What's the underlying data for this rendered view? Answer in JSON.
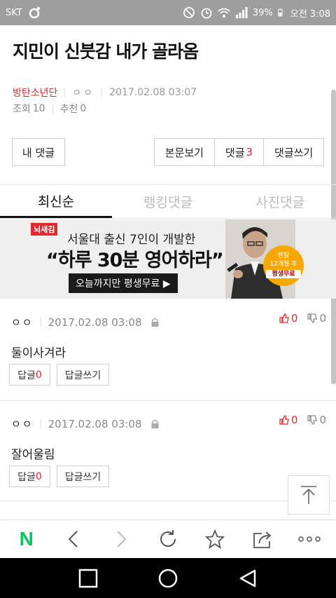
{
  "status_bar": {
    "carrier": "SKT",
    "battery": "39%",
    "time": "오전 3:08"
  },
  "post": {
    "title": "지민이 신붓감 내가 골라옴",
    "category": "방탄소년단",
    "author": "ㅇㅇ",
    "datetime": "2017.02.08 03:07",
    "views_label": "조회",
    "views": "10",
    "recommend_label": "추천",
    "recommend": "0"
  },
  "buttons": {
    "my_comments": "내 댓글",
    "view_body": "본문보기",
    "comments_label": "댓글",
    "comments_count": "3",
    "write_comment": "댓글쓰기"
  },
  "tabs": [
    {
      "label": "최신순",
      "active": true
    },
    {
      "label": "랭킹댓글",
      "active": false
    },
    {
      "label": "사진댓글",
      "active": false
    }
  ],
  "ad": {
    "logo": "뇌새김",
    "line1": "서울대 출신 7인이 개발한",
    "line2": "“하루 30분 영어하라”",
    "cta": "오늘까지만 평생무료 ▶",
    "badge_top": "렌탈",
    "badge_mid": "12개월 후",
    "badge_bottom": "평생무료"
  },
  "comments": [
    {
      "author": "ㅇㅇ",
      "datetime": "2017.02.08 03:08",
      "likes": "0",
      "dislikes": "0",
      "text": "둘이사겨라",
      "reply_label": "답글",
      "reply_count": "0",
      "write_reply": "답글쓰기"
    },
    {
      "author": "ㅇㅇ",
      "datetime": "2017.02.08 03:08",
      "likes": "0",
      "dislikes": "0",
      "text": "잘어울림",
      "reply_label": "답글",
      "reply_count": "0",
      "write_reply": "답글쓰기"
    }
  ],
  "browser_bar": {
    "naver_logo": "N"
  },
  "colors": {
    "accent_red": "#e6282d",
    "naver_green": "#03c75a"
  }
}
